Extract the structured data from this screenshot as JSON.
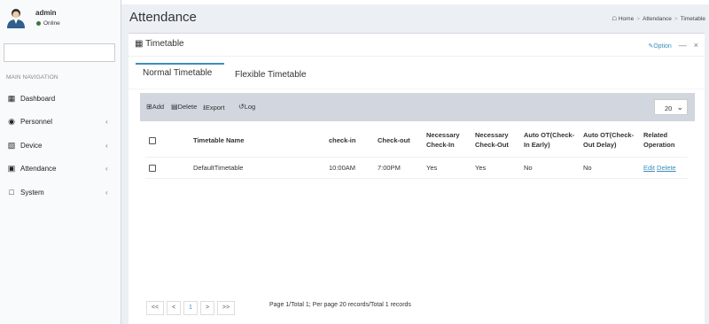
{
  "user": {
    "name": "admin",
    "status": "Online"
  },
  "nav": {
    "header": "MAIN NAVIGATION",
    "items": [
      {
        "icon": "dashboard-icon",
        "label": "Dashboard",
        "has_children": false
      },
      {
        "icon": "personnel-icon",
        "label": "Personnel",
        "has_children": true
      },
      {
        "icon": "device-icon",
        "label": "Device",
        "has_children": true
      },
      {
        "icon": "attendance-icon",
        "label": "Attendance",
        "has_children": true
      },
      {
        "icon": "system-icon",
        "label": "System",
        "has_children": true
      }
    ],
    "chevron": "‹"
  },
  "header": {
    "title": "Attendance",
    "breadcrumb": [
      "Home",
      "Attendance",
      "Timetable"
    ],
    "breadcrumb_sep": ">"
  },
  "box": {
    "title": "Timetable",
    "option_label": "Option",
    "minimize": "—",
    "close": "×"
  },
  "tabs": [
    {
      "label": "Normal Timetable",
      "active": true
    },
    {
      "label": "Flexible Timetable",
      "active": false
    }
  ],
  "toolbar": {
    "add": "Add",
    "delete": "Delete",
    "export": "Export",
    "log": "Log",
    "page_size": "20"
  },
  "table": {
    "headers": {
      "name": "Timetable Name",
      "checkin": "check-in",
      "checkout": "Check-out",
      "nec_in": [
        "Necessary",
        "Check-In"
      ],
      "nec_out": [
        "Necessary",
        "Check-Out"
      ],
      "ot_early": [
        "Auto OT(Check-",
        "In Early)"
      ],
      "ot_delay": [
        "Auto OT(Check-",
        "Out Delay)"
      ],
      "related": [
        "Related",
        "Operation"
      ]
    },
    "rows": [
      {
        "name": "DefaultTimetable",
        "checkin": "10:00AM",
        "checkout": "7:00PM",
        "nec_in": "Yes",
        "nec_out": "Yes",
        "ot_early": "No",
        "ot_delay": "No",
        "edit": "Edit",
        "delete": "Delete"
      }
    ]
  },
  "pager": {
    "first": "<<",
    "prev": "<",
    "current": "1",
    "next": ">",
    "last": ">>",
    "info": "Page 1/Total 1; Per page 20 records/Total 1 records"
  },
  "colors": {
    "accent": "#3c8dbc",
    "online": "#3c763d",
    "toolbar_bg": "#d2d6de",
    "content_bg": "#ecf0f5"
  }
}
